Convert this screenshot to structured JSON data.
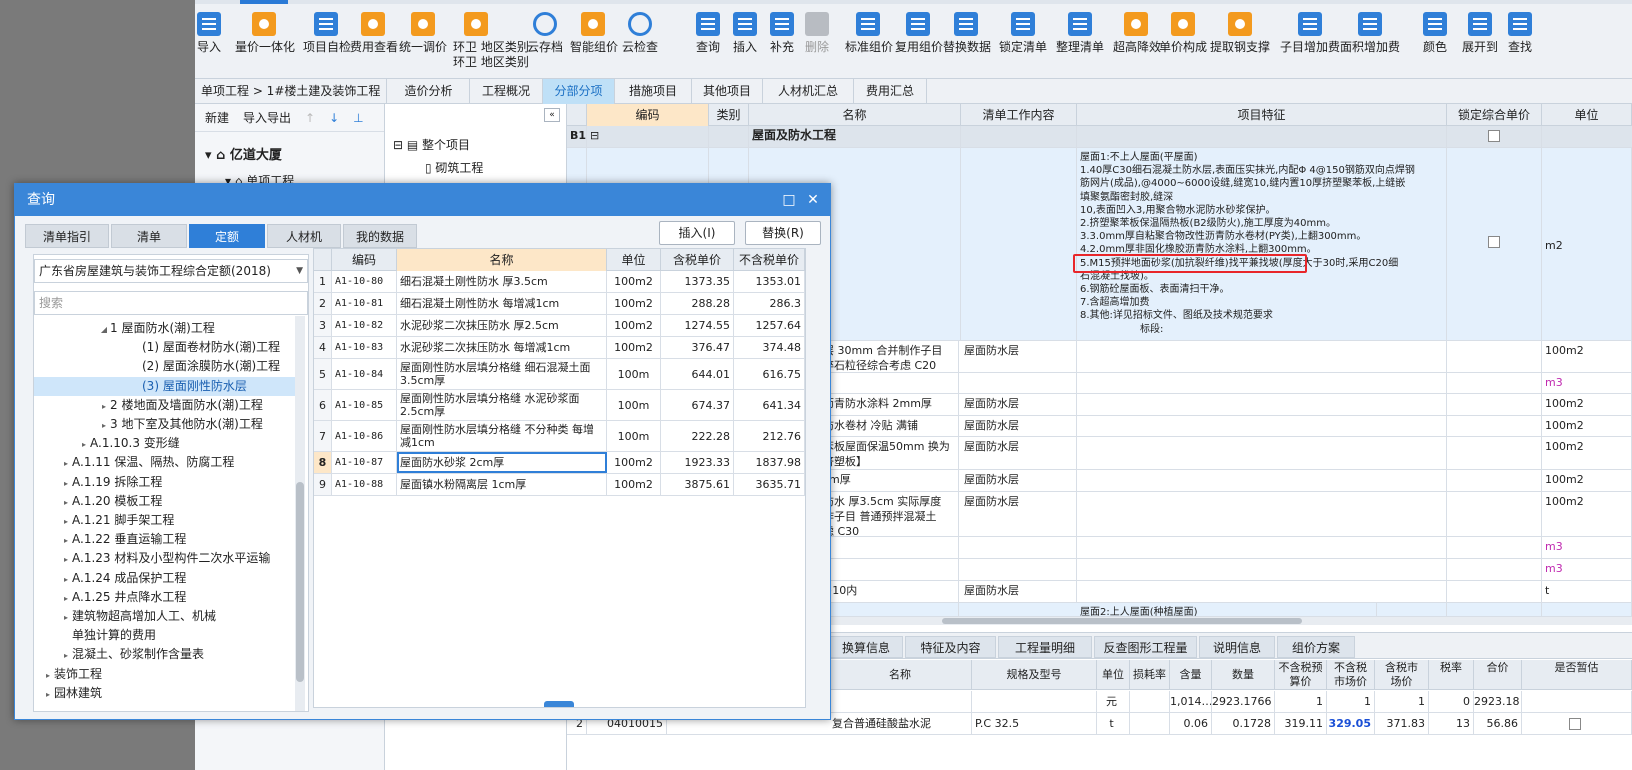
{
  "toolbar": {
    "buttons": [
      "导入",
      "量价一体化",
      "项目自检",
      "费用查看",
      "统一调价",
      "环卫\n地区类别",
      "云存档",
      "智能组价",
      "云检查",
      "查询",
      "插入",
      "补充",
      "删除",
      "标准组价",
      "复用组价",
      "替换数据",
      "锁定清单",
      "整理清单",
      "超高降效",
      "单价构成",
      "提取钢支撑",
      "子目增加费",
      "面积增加费",
      "颜色",
      "展开到",
      "查找"
    ]
  },
  "tabs": {
    "breadcrumb": "单项工程 > 1#楼土建及装饰工程",
    "items": [
      "造价分析",
      "工程概况",
      "分部分项",
      "措施项目",
      "其他项目",
      "人材机汇总",
      "费用汇总"
    ]
  },
  "left_panel": {
    "new": "新建",
    "import_export": "导入导出",
    "project": "亿道大厦",
    "sub": "单项工程"
  },
  "tree2": {
    "root": "整个项目",
    "child": "砌筑工程"
  },
  "grid": {
    "headers": [
      "编码",
      "类别",
      "名称",
      "清单工作内容",
      "项目特征",
      "锁定综合单价",
      "单位"
    ],
    "b1": {
      "code": "B1",
      "name": "屋面及防水工程"
    },
    "feature_lines": [
      "屋面1:不上人屋面(平屋面)",
      "1.40厚C30细石混凝土防水层,表面压实抹光,内配Φ 4@150钢筋双向点焊钢",
      "筋网片(成品),@4000~6000设缝,缝宽10,缝内置10厚挤塑聚苯板,上缝嵌",
      "填聚氨酯密封胶,缝深",
      "10,表面凹入3,用聚合物水泥防水砂浆保护。",
      "2.挤塑聚苯板保温隔热板(B2级防火),施工厚度为40mm。",
      "3.3.0mm厚自粘聚合物改性沥青防水卷材(PY类),上翻300mm。",
      "4.2.0mm厚非固化橡胶沥青防水涂料,上翻300mm。",
      "5.M15预拌地面砂浆(加抗裂纤维)找平兼找坡(厚度大于30时,采用C20细",
      "石混凝土找坡)。",
      "6.钢筋砼屋面板、表面清扫干净。",
      "7.含超高增加费",
      "8.其他:详见招标文件、图纸及技术规范要求",
      "标段:"
    ],
    "unit_main": "m2",
    "rows": [
      {
        "name": "层 30mm 合并制作子目\n碎石粒径综合考虑 C20",
        "work": "屋面防水层",
        "unit": "100m2"
      },
      {
        "name": "",
        "work": "",
        "unit": "m3"
      },
      {
        "name": "沥青防水涂料 2mm厚",
        "work": "屋面防水层",
        "unit": "100m2"
      },
      {
        "name": "防水卷材 冷贴 满铺",
        "work": "屋面防水层",
        "unit": "100m2"
      },
      {
        "name": "苯板屋面保温50mm 换为\n挤塑板】",
        "work": "屋面防水层",
        "unit": "100m2"
      },
      {
        "name": "cm厚",
        "work": "屋面防水层",
        "unit": "100m2"
      },
      {
        "name": "防水 厚3.5cm 实际厚度\n作子目 普通预拌混凝土\n虑 C30",
        "work": "屋面防水层",
        "unit": "100m2"
      },
      {
        "name": "",
        "work": "",
        "unit": "m3"
      },
      {
        "name": "",
        "work": "",
        "unit": "m3"
      },
      {
        "name": ">10内",
        "work": "屋面防水层",
        "unit": "t"
      },
      {
        "name": "",
        "work": "屋面2:上人屋面(种植屋面)",
        "unit": ""
      }
    ]
  },
  "bottom": {
    "tabs": [
      "换算信息",
      "特征及内容",
      "工程量明细",
      "反查图形工程量",
      "说明信息",
      "组价方案"
    ],
    "headers": [
      "名称",
      "规格及型号",
      "单位",
      "损耗率",
      "含量",
      "数量",
      "不含税预\n算价",
      "不含税\n市场价",
      "含税市\n场价",
      "税率",
      "合价",
      "是否暂估"
    ],
    "rows": [
      {
        "no": "",
        "code": "",
        "name": "",
        "spec": "",
        "unit": "元",
        "loss": "",
        "content": "1,014…",
        "qty": "2923.1766",
        "p1": "1",
        "p2": "1",
        "p3": "1",
        "tax": "0",
        "sum": "2923.18"
      },
      {
        "no": "2",
        "code": "04010015",
        "name": "复合普通硅酸盐水泥",
        "spec": "P.C 32.5",
        "unit": "t",
        "loss": "",
        "content": "0.06",
        "qty": "0.1728",
        "p1": "319.11",
        "p2": "329.05",
        "p3": "371.83",
        "tax": "13",
        "sum": "56.86"
      }
    ]
  },
  "dialog": {
    "title": "查询",
    "tabs": [
      "清单指引",
      "清单",
      "定额",
      "人材机",
      "我的数据"
    ],
    "insert": "插入(I)",
    "replace": "替换(R)",
    "quota_select": "广东省房屋建筑与装饰工程综合定额(2018)",
    "search_placeholder": "搜索",
    "tree": [
      {
        "t": "1 屋面防水(潮)工程",
        "i": 64,
        "tg": "◢"
      },
      {
        "t": "(1) 屋面卷材防水(潮)工程",
        "i": 96,
        "tg": ""
      },
      {
        "t": "(2) 屋面涂膜防水(潮)工程",
        "i": 96,
        "tg": ""
      },
      {
        "t": "(3) 屋面刚性防水层",
        "i": 96,
        "tg": ""
      },
      {
        "t": "2 楼地面及墙面防水(潮)工程",
        "i": 64,
        "tg": "▸"
      },
      {
        "t": "3 地下室及其他防水(潮)工程",
        "i": 64,
        "tg": "▸"
      },
      {
        "t": "A.1.10.3 变形缝",
        "i": 44,
        "tg": "▸"
      },
      {
        "t": "A.1.11 保温、隔热、防腐工程",
        "i": 26,
        "tg": "▸"
      },
      {
        "t": "A.1.19 拆除工程",
        "i": 26,
        "tg": "▸"
      },
      {
        "t": "A.1.20 模板工程",
        "i": 26,
        "tg": "▸"
      },
      {
        "t": "A.1.21 脚手架工程",
        "i": 26,
        "tg": "▸"
      },
      {
        "t": "A.1.22 垂直运输工程",
        "i": 26,
        "tg": "▸"
      },
      {
        "t": "A.1.23 材料及小型构件二次水平运输",
        "i": 26,
        "tg": "▸"
      },
      {
        "t": "A.1.24 成品保护工程",
        "i": 26,
        "tg": "▸"
      },
      {
        "t": "A.1.25 井点降水工程",
        "i": 26,
        "tg": "▸"
      },
      {
        "t": "建筑物超高增加人工、机械",
        "i": 26,
        "tg": "▸"
      },
      {
        "t": "单独计算的费用",
        "i": 26,
        "tg": ""
      },
      {
        "t": "混凝土、砂浆制作含量表",
        "i": 26,
        "tg": "▸"
      },
      {
        "t": "装饰工程",
        "i": 8,
        "tg": "▸"
      },
      {
        "t": "园林建筑",
        "i": 8,
        "tg": "▸"
      }
    ],
    "table_headers": [
      "",
      "编码",
      "名称",
      "单位",
      "含税单价",
      "不含税单价"
    ],
    "rows": [
      {
        "n": "1",
        "code": "A1-10-80",
        "name": "细石混凝土刚性防水 厚3.5cm",
        "unit": "100m2",
        "p1": "1373.35",
        "p2": "1353.01"
      },
      {
        "n": "2",
        "code": "A1-10-81",
        "name": "细石混凝土刚性防水 每增减1cm",
        "unit": "100m2",
        "p1": "288.28",
        "p2": "286.3"
      },
      {
        "n": "3",
        "code": "A1-10-82",
        "name": "水泥砂浆二次抹压防水 厚2.5cm",
        "unit": "100m2",
        "p1": "1274.55",
        "p2": "1257.64"
      },
      {
        "n": "4",
        "code": "A1-10-83",
        "name": "水泥砂浆二次抹压防水 每增减1cm",
        "unit": "100m2",
        "p1": "376.47",
        "p2": "374.48"
      },
      {
        "n": "5",
        "code": "A1-10-84",
        "name": "屋面刚性防水层填分格缝 细石混凝土面3.5cm厚",
        "unit": "100m",
        "p1": "644.01",
        "p2": "616.75"
      },
      {
        "n": "6",
        "code": "A1-10-85",
        "name": "屋面刚性防水层填分格缝 水泥砂浆面2.5cm厚",
        "unit": "100m",
        "p1": "674.37",
        "p2": "641.34"
      },
      {
        "n": "7",
        "code": "A1-10-86",
        "name": "屋面刚性防水层填分格缝 不分种类 每增减1cm",
        "unit": "100m",
        "p1": "222.28",
        "p2": "212.76"
      },
      {
        "n": "8",
        "code": "A1-10-87",
        "name": "屋面防水砂浆 2cm厚",
        "unit": "100m2",
        "p1": "1923.33",
        "p2": "1837.98"
      },
      {
        "n": "9",
        "code": "A1-10-88",
        "name": "屋面镇水粉隔离层 1cm厚",
        "unit": "100m2",
        "p1": "3875.61",
        "p2": "3635.71"
      }
    ]
  }
}
